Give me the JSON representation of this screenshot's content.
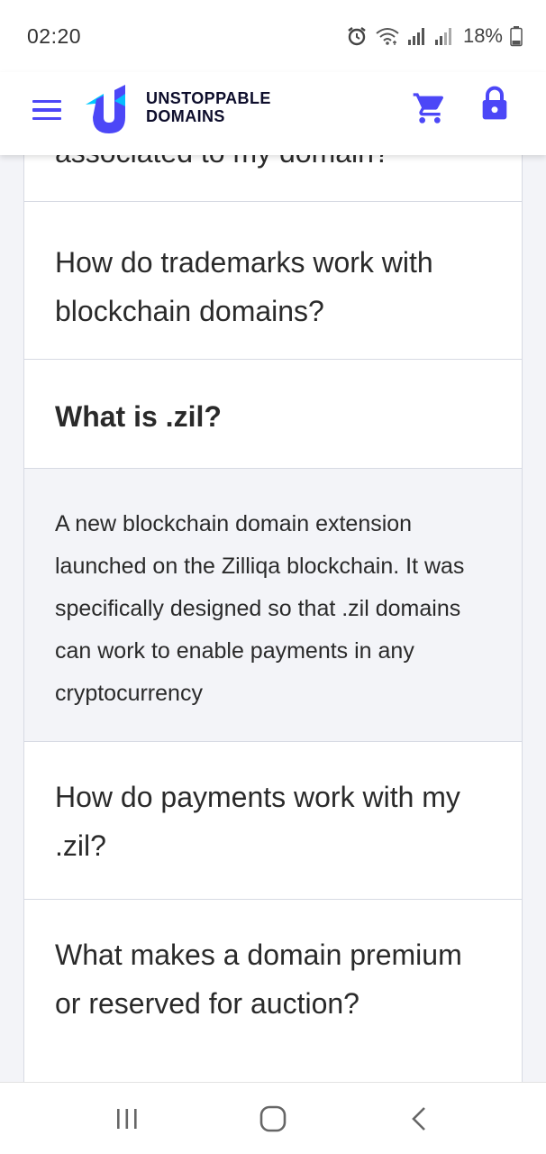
{
  "status_bar": {
    "time": "02:20",
    "battery_percent": "18%",
    "icons": [
      "alarm-icon",
      "wifi-icon",
      "signal-icon",
      "signal-icon",
      "battery-icon"
    ]
  },
  "header": {
    "brand_line1": "UNSTOPPABLE",
    "brand_line2": "DOMAINS",
    "accent_color": "#4c47f7",
    "icons": [
      "menu-icon",
      "cart-icon",
      "lock-icon"
    ]
  },
  "faq": {
    "partial_question": "associated to my domain?",
    "items": [
      {
        "question": "How do trademarks work with blockchain domains?"
      },
      {
        "question": "What is .zil?",
        "expanded": true,
        "answer": "A new blockchain domain extension launched on the Zilliqa blockchain. It was specifically designed so that .zil domains can work to enable payments in any cryptocurrency"
      },
      {
        "question": "How do payments work with my .zil?"
      },
      {
        "question": "What makes a domain premium or reserved for auction?"
      }
    ]
  },
  "nav": {
    "icons": [
      "recent-apps-icon",
      "home-icon",
      "back-icon"
    ]
  }
}
